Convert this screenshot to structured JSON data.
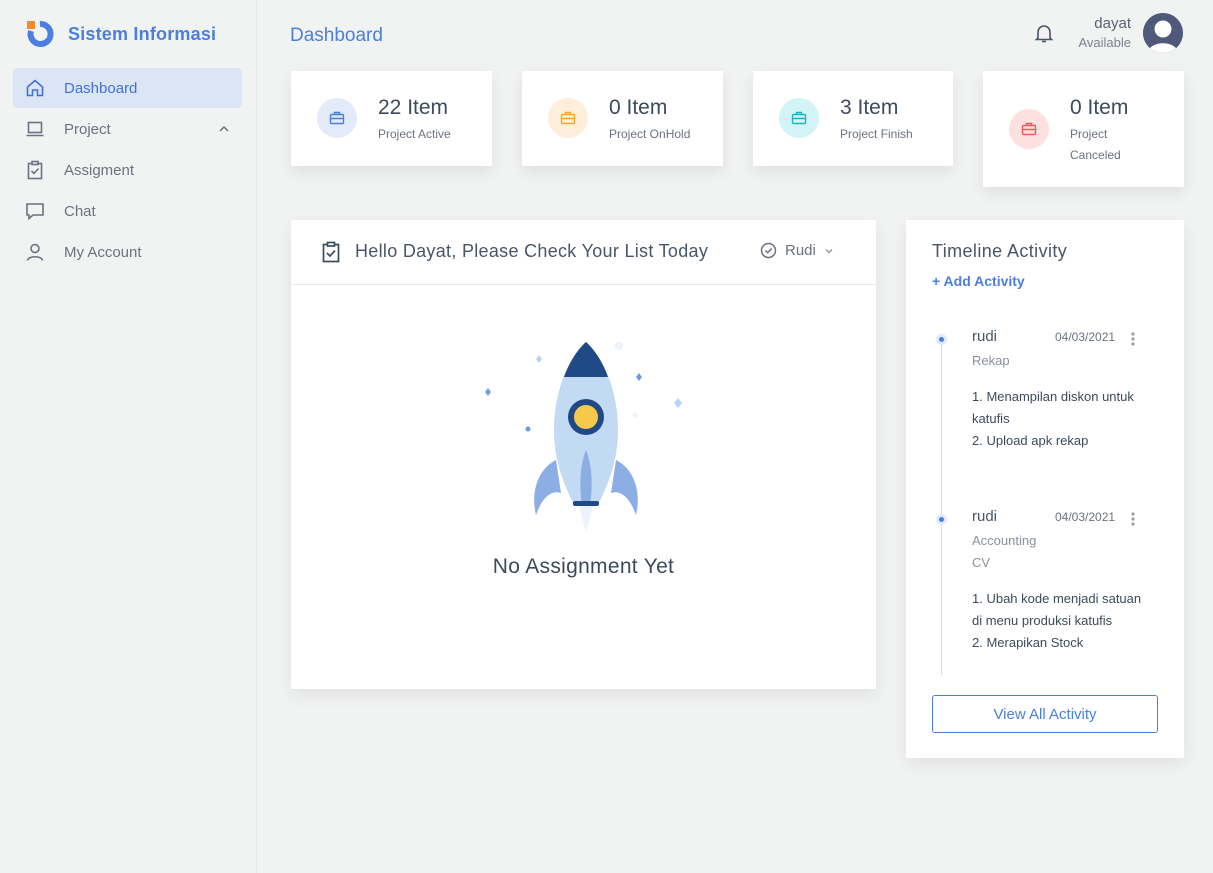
{
  "app": {
    "brand": "Sistem Informasi",
    "accent": "#4a7fe0"
  },
  "sidebar": {
    "items": [
      {
        "label": "Dashboard",
        "icon": "home-icon",
        "active": true
      },
      {
        "label": "Project",
        "icon": "laptop-icon",
        "expandable": true
      },
      {
        "label": "Assigment",
        "icon": "clipboard-check-icon"
      },
      {
        "label": "Chat",
        "icon": "chat-icon"
      },
      {
        "label": "My Account",
        "icon": "user-icon"
      }
    ]
  },
  "header": {
    "title": "Dashboard",
    "user_name": "dayat",
    "user_status": "Available"
  },
  "stats": [
    {
      "count": "22 Item",
      "label": "Project Active",
      "color": "#4a7fe0",
      "bg": "#e3ebfa"
    },
    {
      "count": "0 Item",
      "label": "Project OnHold",
      "color": "#f5a43a",
      "bg": "#fdefdc"
    },
    {
      "count": "3 Item",
      "label": "Project Finish",
      "color": "#19b7c6",
      "bg": "#d3f4f7"
    },
    {
      "count": "0 Item",
      "label": "Project Canceled",
      "color": "#ea5b5b",
      "bg": "#fde0e0"
    }
  ],
  "assignments": {
    "title": "Hello Dayat, Please Check Your List Today",
    "filter_value": "Rudi",
    "empty_message": "No Assignment Yet"
  },
  "timeline": {
    "title": "Timeline Activity",
    "add_label": "+ Add Activity",
    "entries": [
      {
        "user": "rudi",
        "date": "04/03/2021",
        "subtitle_lines": [
          "Rekap"
        ],
        "body_lines": [
          "1. Menampilan diskon untuk katufis",
          "2. Upload apk rekap"
        ]
      },
      {
        "user": "rudi",
        "date": "04/03/2021",
        "subtitle_lines": [
          "Accounting",
          "CV"
        ],
        "body_lines": [
          "1. Ubah kode menjadi satuan di menu produksi katufis",
          "2. Merapikan Stock"
        ]
      }
    ],
    "view_all_label": "View All Activity"
  }
}
